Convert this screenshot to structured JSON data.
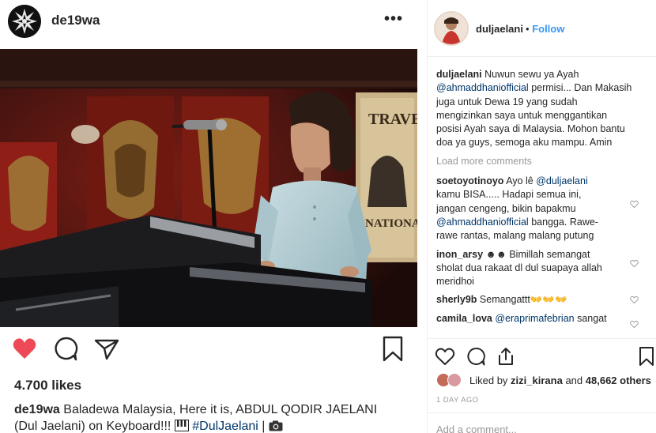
{
  "post": {
    "username": "de19wa",
    "more_icon": "more-horizontal-icon",
    "likes": "4.700 likes",
    "caption": {
      "username": "de19wa",
      "text": "Baladewa Malaysia, Here it is, ABDUL QODIR JAELANI (Dul Jaelani) on Keyboard!!!",
      "hashtag": "#DulJaelani",
      "tail": "|"
    },
    "actions": [
      "heart-icon",
      "comment-icon",
      "share-icon",
      "bookmark-icon"
    ]
  },
  "panel": {
    "username": "duljaelani",
    "separator": "•",
    "follow_label": "Follow",
    "first_comment": {
      "user": "duljaelani",
      "text_a": "Nuwun sewu ya Ayah",
      "mention": "@ahmaddhaniofficial",
      "text_b": "permisi... Dan Makasih juga untuk Dewa 19 yang sudah mengizinkan saya untuk menggantikan posisi Ayah saya di Malaysia. Mohon bantu doa ya guys, semoga aku mampu. Amin"
    },
    "load_more": "Load more comments",
    "comments": [
      {
        "user": "soetoyotinoyo",
        "text_a": "Ayo lê",
        "mention_a": "@duljaelani",
        "text_b": "kamu BISA..... Hadapi semua ini, jangan cengeng, bikin bapakmu",
        "mention_b": "@ahmaddhaniofficial",
        "text_c": "bangga. Rawe-rawe rantas, malang malang putung"
      },
      {
        "user": "inon_arsy",
        "emoji": "☻☻",
        "text_a": "Bimillah semangat sholat dua rakaat dl dul suapaya allah meridhoi"
      },
      {
        "user": "sherly9b",
        "text_a": "Semangattt👐👐👐"
      },
      {
        "user": "camila_lova",
        "mention_a": "@eraprimafebrian",
        "text_a": "sangat"
      }
    ],
    "liked_by": {
      "prefix": "Liked by",
      "user": "zizi_kirana",
      "middle": "and",
      "count": "48,662 others"
    },
    "date": "1 DAY AGO",
    "add_comment_placeholder": "Add a comment..."
  },
  "colors": {
    "like_red": "#ed4956",
    "link_blue": "#3897f0",
    "mention_navy": "#003569",
    "muted_gray": "#999999"
  }
}
